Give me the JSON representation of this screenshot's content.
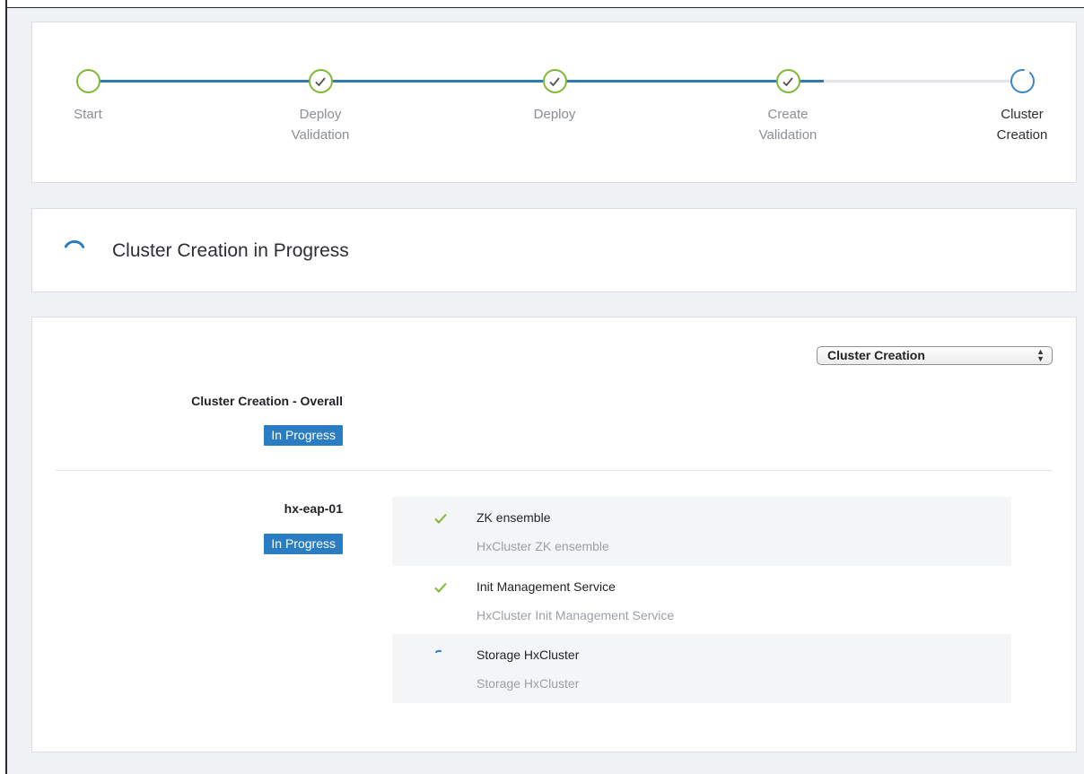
{
  "wizard": {
    "steps": [
      {
        "label": "Start"
      },
      {
        "label": "Deploy Validation"
      },
      {
        "label": "Deploy"
      },
      {
        "label": "Create Validation"
      },
      {
        "label": "Cluster Creation"
      }
    ]
  },
  "status": {
    "title": "Cluster Creation in Progress"
  },
  "details": {
    "selector": {
      "selected": "Cluster Creation"
    },
    "overall": {
      "title": "Cluster Creation - Overall",
      "badge": "In Progress"
    },
    "node": {
      "name": "hx-eap-01",
      "badge": "In Progress",
      "tasks": [
        {
          "name": "ZK ensemble",
          "description": "HxCluster ZK ensemble",
          "state": "done"
        },
        {
          "name": "Init Management Service",
          "description": "HxCluster Init Management Service",
          "state": "done"
        },
        {
          "name": "Storage HxCluster",
          "description": "Storage HxCluster",
          "state": "in-progress"
        }
      ]
    }
  },
  "colors": {
    "accent": "#2a7cc3",
    "success": "#7fb934",
    "muted_text": "#9aa0a6"
  }
}
